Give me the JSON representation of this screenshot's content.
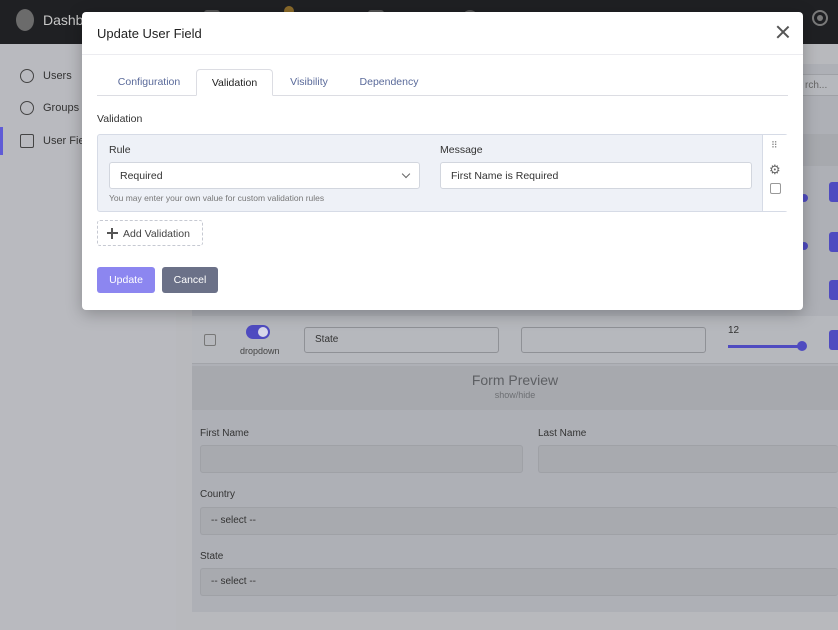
{
  "topbar": {
    "brand": "Dashbo"
  },
  "sidebar": {
    "items": [
      {
        "label": "Users",
        "icon": "user-icon"
      },
      {
        "label": "Groups",
        "icon": "groups-icon"
      },
      {
        "label": "User Fie",
        "icon": "checkbox-icon"
      }
    ]
  },
  "background": {
    "search_fragment": "rch...",
    "row": {
      "toggle_label": "dropdown",
      "field_name": "State",
      "field_value": "",
      "number": "12"
    },
    "preview": {
      "title": "Form Preview",
      "subtitle": "show/hide",
      "first_name_label": "First Name",
      "last_name_label": "Last Name",
      "country_label": "Country",
      "country_value": "-- select --",
      "state_label": "State",
      "state_value": "-- select --"
    }
  },
  "modal": {
    "title": "Update User Field",
    "tabs": [
      {
        "label": "Configuration"
      },
      {
        "label": "Validation",
        "active": true
      },
      {
        "label": "Visibility"
      },
      {
        "label": "Dependency"
      }
    ],
    "section_label": "Validation",
    "rule_label": "Rule",
    "rule_value": "Required",
    "rule_hint": "You may enter your own value for custom validation rules",
    "message_label": "Message",
    "message_value": "First Name is Required",
    "add_validation_label": "Add Validation",
    "update_label": "Update",
    "cancel_label": "Cancel"
  },
  "colors": {
    "accent": "#8c86f0",
    "cancel": "#6b7188",
    "topbar": "#1f2023"
  }
}
